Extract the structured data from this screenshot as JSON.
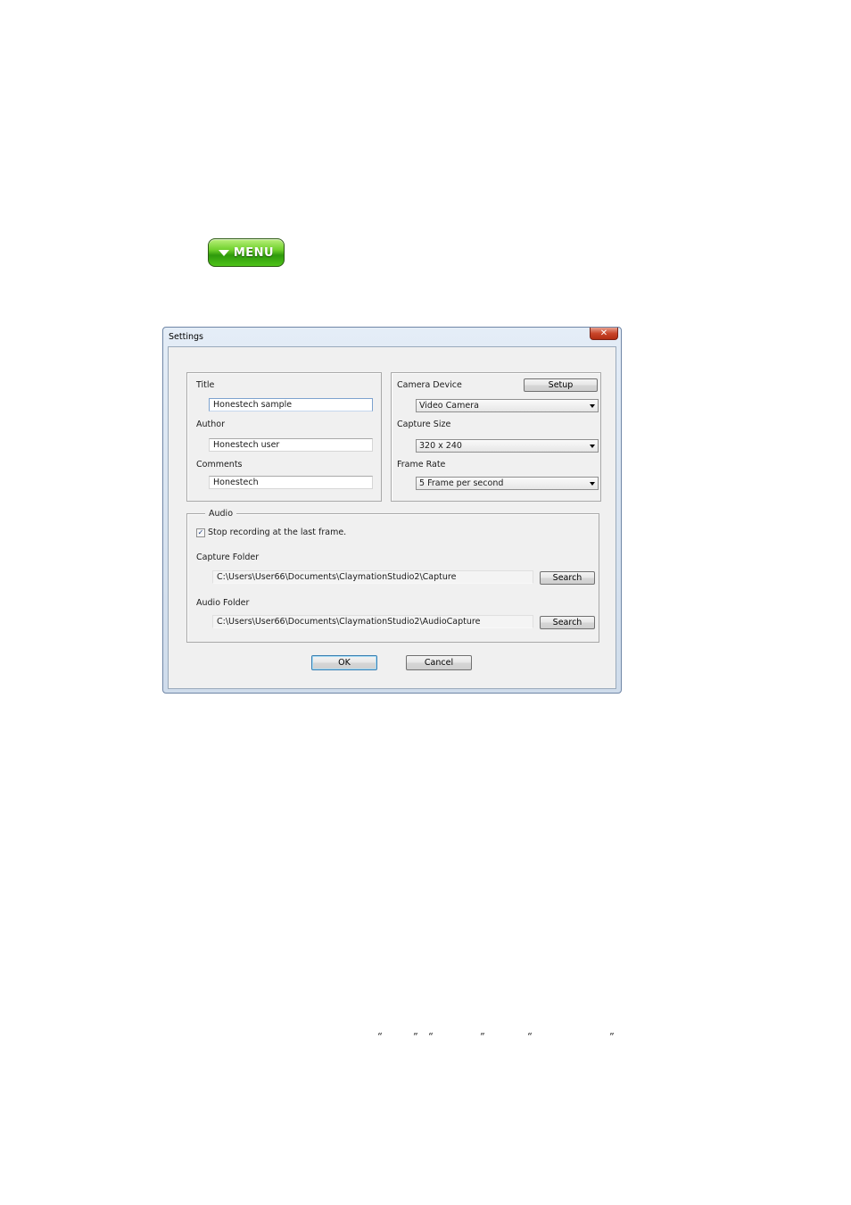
{
  "menu_button": {
    "label": "MENU"
  },
  "window": {
    "title": "Settings",
    "close_glyph": "✕",
    "info": {
      "title_label": "Title",
      "title_value": "Honestech sample",
      "author_label": "Author",
      "author_value": "Honestech user",
      "comments_label": "Comments",
      "comments_value": "Honestech"
    },
    "camera": {
      "device_label": "Camera Device",
      "setup_label": "Setup",
      "device_value": "Video Camera",
      "size_label": "Capture Size",
      "size_value": "320 x 240",
      "rate_label": "Frame Rate",
      "rate_value": "5 Frame per second"
    },
    "audio": {
      "group_label": "Audio",
      "stop_checkbox_label": "Stop recording at the last frame.",
      "stop_checked": true,
      "check_glyph": "✓",
      "capture_folder_label": "Capture Folder",
      "capture_folder_value": "C:\\Users\\User66\\Documents\\ClaymationStudio2\\Capture",
      "capture_search_label": "Search",
      "audio_folder_label": "Audio Folder",
      "audio_folder_value": "C:\\Users\\User66\\Documents\\ClaymationStudio2\\AudioCapture",
      "audio_search_label": "Search"
    },
    "ok_label": "OK",
    "cancel_label": "Cancel"
  },
  "footer_quotes": {
    "open": "“",
    "close": "”"
  }
}
